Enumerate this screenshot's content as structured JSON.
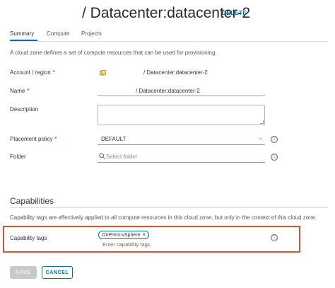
{
  "header": {
    "title": "/ Datacenter:datacenter-2",
    "delete_label": "DELETE"
  },
  "tabs": [
    {
      "label": "Summary",
      "active": true
    },
    {
      "label": "Compute",
      "active": false
    },
    {
      "label": "Projects",
      "active": false
    }
  ],
  "intro": "A cloud zone defines a set of compute resources that can be used for provisioning.",
  "form": {
    "account_region": {
      "label": "Account / region",
      "required_mark": "*",
      "value": "/ Datacenter:datacenter-2"
    },
    "name": {
      "label": "Name",
      "required_mark": "*",
      "value": "/ Datacenter:datacenter-2"
    },
    "description": {
      "label": "Description",
      "value": ""
    },
    "placement_policy": {
      "label": "Placement policy",
      "required_mark": "*",
      "value": "DEFAULT"
    },
    "folder": {
      "label": "Folder",
      "placeholder": "Select folder",
      "value": ""
    }
  },
  "capabilities": {
    "title": "Capabilities",
    "description": "Capability tags are effectively applied to all compute resources in this cloud zone, but only in the context of this cloud zone.",
    "tags_label": "Capability tags",
    "tags": [
      "OnPrem-vSphere"
    ],
    "tags_placeholder": "Enter capability tags"
  },
  "actions": {
    "save_label": "SAVE",
    "cancel_label": "CANCEL"
  },
  "icons": {
    "info": "ⓘ",
    "chevron": "⌄",
    "chip_remove": "×"
  },
  "colors": {
    "accent": "#0072a3",
    "required": "#c92100",
    "highlight": "#d9532f",
    "disabled": "#c9c9c9"
  }
}
